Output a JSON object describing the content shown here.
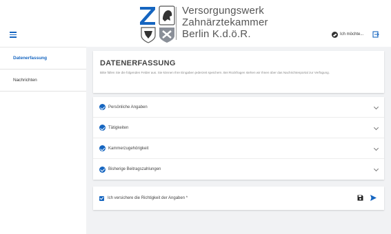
{
  "header": {
    "logo_lines": [
      "Versorgungswerk",
      "Zahnärztekammer",
      "Berlin K.d.ö.R."
    ],
    "user_label": "Ich möchte...",
    "menu_icon": "hamburger-menu-icon",
    "logout_icon": "logout-icon"
  },
  "sidebar": {
    "items": [
      {
        "label": "Datenerfassung",
        "active": true
      },
      {
        "label": "Nachrichten",
        "active": false
      }
    ]
  },
  "intro": {
    "title": "DATENERFASSUNG",
    "text": "Bitte füllen Sie die folgenden Felder aus. Sie können Ihre Eingaben jederzeit speichern. Bei Rückfragen stehen wir Ihnen über das Nachrichtenportal zur Verfügung."
  },
  "sections": [
    {
      "label": "Persönliche Angaben"
    },
    {
      "label": "Tätigkeiten"
    },
    {
      "label": "Kammerzugehörigkeit"
    },
    {
      "label": "Bisherige Beitragszahlungen"
    }
  ],
  "confirm": {
    "label": "Ich versichere die Richtigkeit der Angaben *",
    "checked": true
  },
  "colors": {
    "accent": "#1565c0",
    "background": "#f1f2f4"
  }
}
